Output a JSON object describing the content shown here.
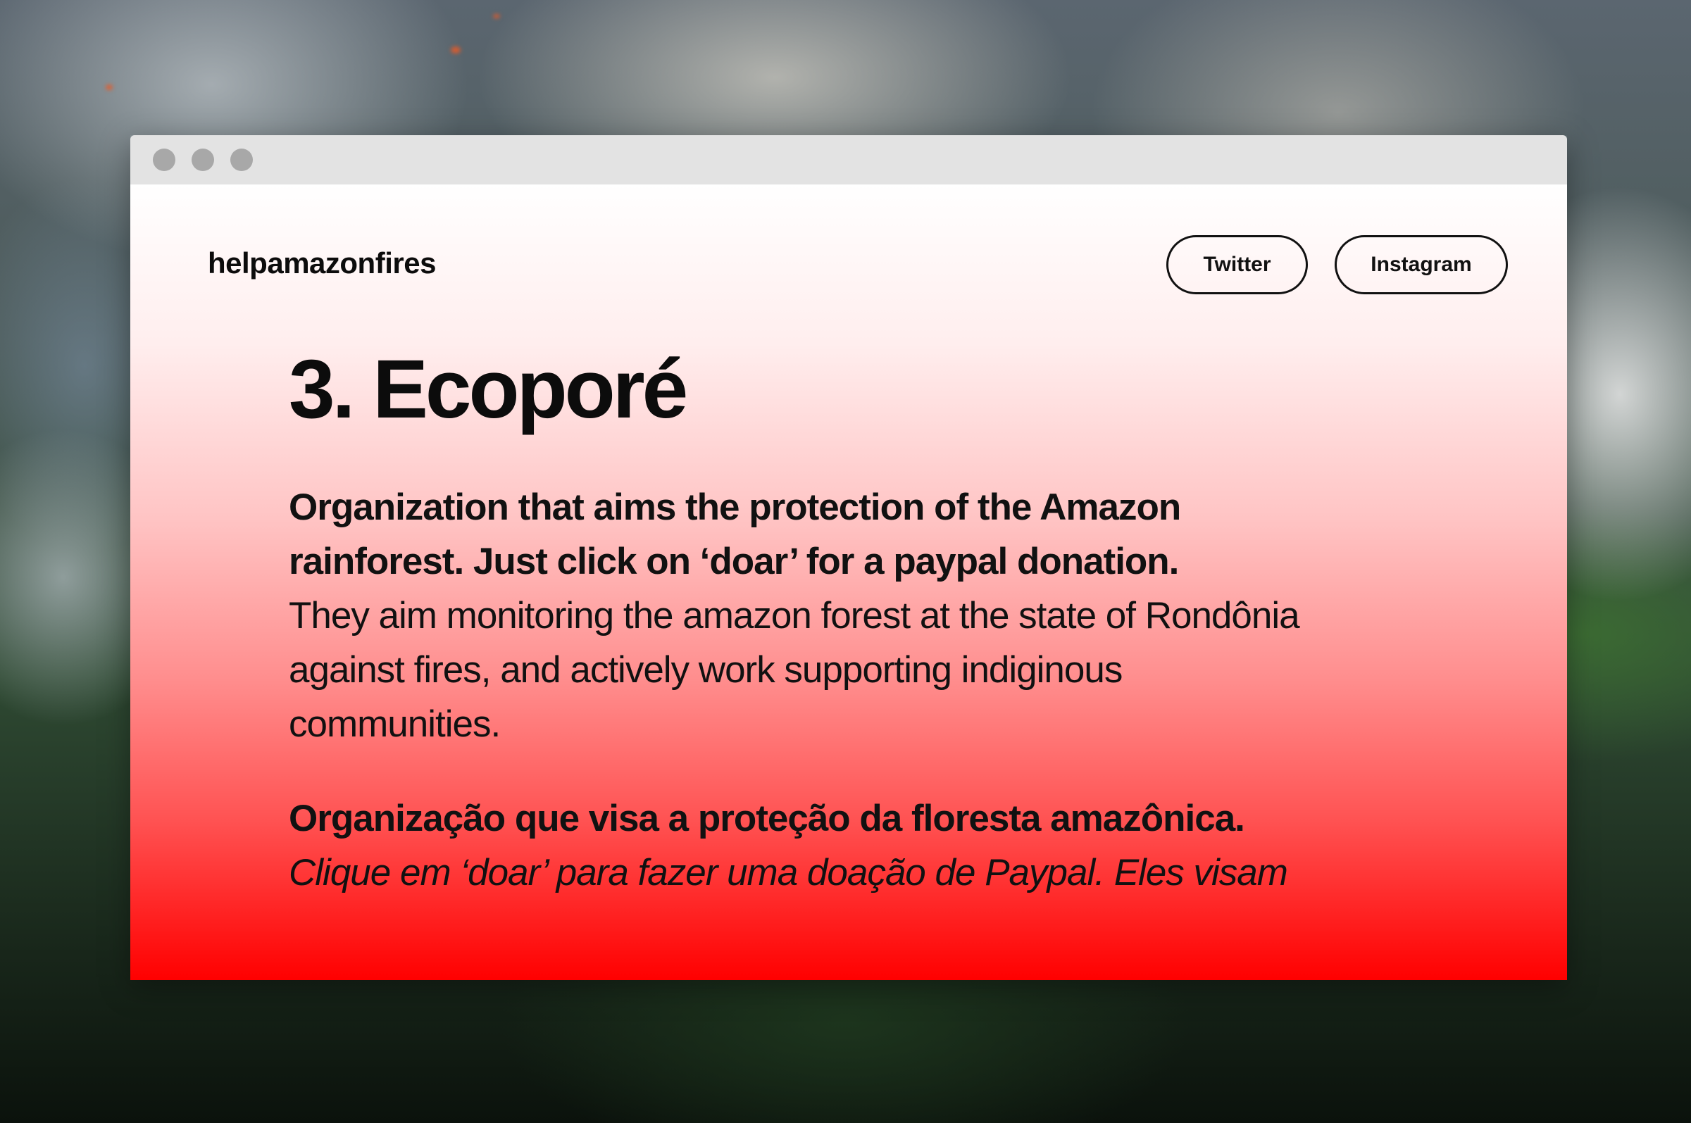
{
  "site": {
    "brand": "helpamazonfires"
  },
  "nav": {
    "twitter_label": "Twitter",
    "instagram_label": "Instagram"
  },
  "article": {
    "heading": "3. Ecoporé",
    "en_bold_line1": "Organization that aims the protection of the Amazon",
    "en_bold_line2": "rainforest. Just click on ‘doar’ for a paypal donation.",
    "en_regular_line1": "They aim monitoring the amazon forest at the state of Rondônia",
    "en_regular_line2": "against fires, and actively work supporting indiginous",
    "en_regular_line3": "communities.",
    "pt_bold_line1": "Organização que visa a proteção da floresta amazônica.",
    "pt_italic_line1": "Clique em ‘doar’ para fazer uma doação de Paypal. Eles visam"
  },
  "colors": {
    "gradient_top": "#ffffff",
    "gradient_bottom": "#ff0000",
    "titlebar": "#e3e3e3",
    "window_dot": "#a8a8a8",
    "text": "#111111"
  }
}
